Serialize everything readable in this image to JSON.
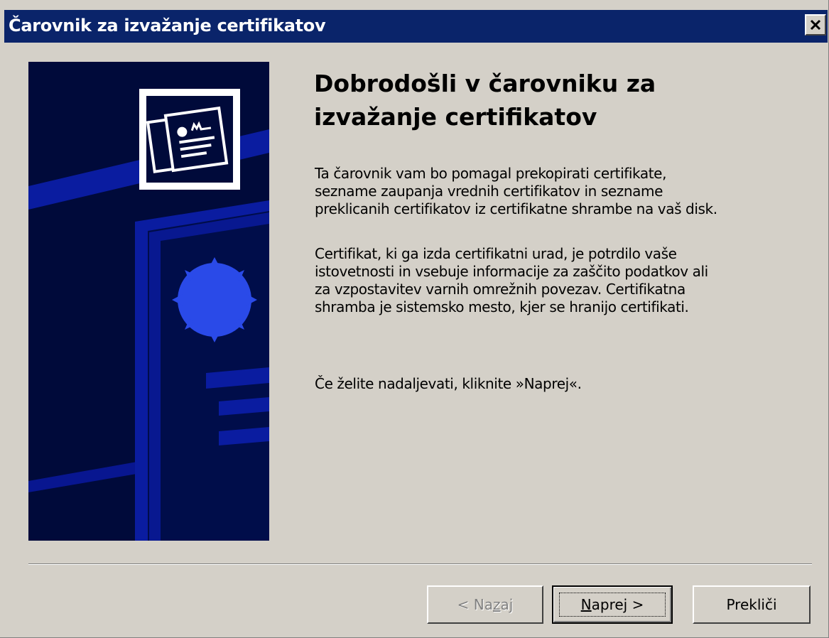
{
  "window": {
    "title": "Čarovnik za izvažanje certifikatov",
    "close_icon": "close-icon"
  },
  "banner": {
    "icon": "certificate-icon",
    "colors": {
      "background": "#000a3a",
      "stripe": "#0a1ca0",
      "seal": "#2a4ae8"
    }
  },
  "content": {
    "heading_lines": [
      "Dobrodošli v čarovniku za",
      "izvažanje certifikatov"
    ],
    "paragraph1_lines": [
      "Ta čarovnik vam bo pomagal prekopirati certifikate,",
      "sezname zaupanja vrednih certifikatov in sezname",
      "preklicanih certifikatov iz certifikatne shrambe na vaš disk."
    ],
    "paragraph2_lines": [
      "Certifikat, ki ga izda certifikatni urad, je potrdilo vaše",
      "istovetnosti in vsebuje informacije za zaščito podatkov ali",
      "za vzpostavitev varnih omrežnih povezav. Certifikatna",
      "shramba je sistemsko mesto, kjer se hranijo certifikati."
    ],
    "paragraph3": "Če želite nadaljevati, kliknite »Naprej«."
  },
  "buttons": {
    "back": {
      "prefix": "< Na",
      "hotkey": "z",
      "suffix": "aj",
      "enabled": false
    },
    "next": {
      "prefix": "",
      "hotkey": "N",
      "suffix": "aprej >",
      "enabled": true
    },
    "cancel": {
      "label": "Prekliči",
      "enabled": true
    }
  },
  "colors": {
    "titlebar": "#0a246a",
    "dialog": "#d4d0c8",
    "disabled_text": "#808080"
  }
}
